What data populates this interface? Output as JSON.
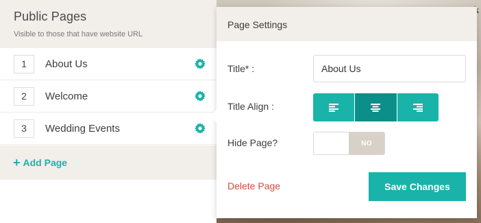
{
  "panel": {
    "title": "Public Pages",
    "subtitle": "Visible to those that have website URL",
    "pages": [
      {
        "number": "1",
        "name": "About Us"
      },
      {
        "number": "2",
        "name": "Welcome"
      },
      {
        "number": "3",
        "name": "Wedding Events"
      }
    ],
    "add_page_label": "Add Page",
    "add_page_icon": "plus-icon",
    "settings_icon": "gear-icon"
  },
  "popover": {
    "header": "Page Settings",
    "title_label": "Title* :",
    "title_value": "About Us",
    "title_align_label": "Title Align :",
    "align_options": [
      "align-left-icon",
      "align-center-icon",
      "align-right-icon"
    ],
    "align_selected": "center",
    "hide_page_label": "Hide Page?",
    "hide_page_value": "NO",
    "delete_label": "Delete Page",
    "save_label": "Save Changes"
  },
  "colors": {
    "accent": "#19b3aa",
    "accent_active": "#0c8f88",
    "header_bg": "#f2eeea",
    "danger": "#d34a3c"
  }
}
